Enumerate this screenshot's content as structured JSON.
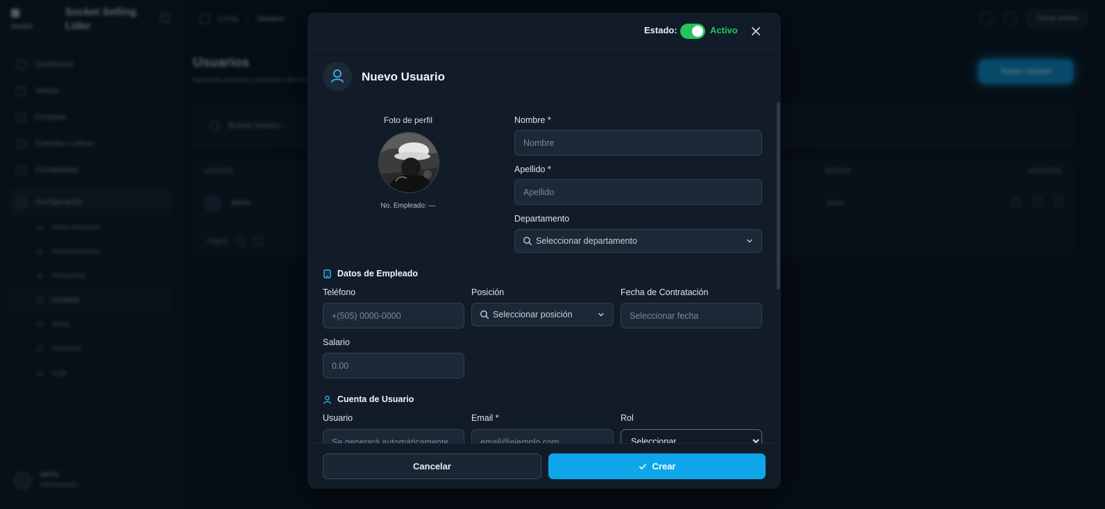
{
  "background": {
    "brand": {
      "subtitle": "Socket",
      "name_line1": "Socket Selling",
      "name_line2": "Líder"
    },
    "nav": [
      {
        "label": "Dashboard"
      },
      {
        "label": "Ventas"
      },
      {
        "label": "Compras"
      },
      {
        "label": "Cuentas x cobrar"
      },
      {
        "label": "Contabilidad"
      }
    ],
    "nav_group": "Configuración",
    "nav_sub": [
      {
        "label": "Datos empresa"
      },
      {
        "label": "Departamentos"
      },
      {
        "label": "Posiciones"
      },
      {
        "label": "Usuarios"
      },
      {
        "label": "Roles"
      },
      {
        "label": "Permisos"
      },
      {
        "label": "Logs"
      }
    ],
    "user": {
      "name": "admin",
      "role": "Administrador"
    },
    "breadcrumb": {
      "parent": "Config",
      "current": "Usuarios"
    },
    "logout_label": "Cerrar sesión",
    "page_title": "Usuarios",
    "page_subtitle": "Gestiona usuarios y permisos del sistema",
    "new_button": "Nuevo Usuario",
    "search_placeholder": "Buscar usuario...",
    "table_headers": {
      "user": "USUARIO",
      "status": "ESTADO",
      "actions": "ACCIONES"
    },
    "table_row": {
      "name": "admin",
      "status": "Activo"
    },
    "pager_label": "Página"
  },
  "modal": {
    "status_label": "Estado:",
    "status_value": "Activo",
    "status_on": true,
    "title": "Nuevo Usuario",
    "photo_label": "Foto de perfil",
    "employee_no": "No. Empleado: —",
    "fields": {
      "nombre": {
        "label": "Nombre *",
        "placeholder": "Nombre"
      },
      "apellido": {
        "label": "Apellido *",
        "placeholder": "Apellido"
      },
      "departamento": {
        "label": "Departamento",
        "placeholder": "Seleccionar departamento"
      },
      "telefono": {
        "label": "Teléfono",
        "placeholder": "+(505) 0000-0000"
      },
      "posicion": {
        "label": "Posición",
        "placeholder": "Seleccionar posición"
      },
      "fecha": {
        "label": "Fecha de Contratación",
        "placeholder": "Seleccionar fecha"
      },
      "salario": {
        "label": "Salario",
        "placeholder": "0.00"
      },
      "usuario": {
        "label": "Usuario",
        "placeholder": "Se generará automáticamente"
      },
      "email": {
        "label": "Email *",
        "placeholder": "email@ejemplo.com"
      },
      "rol": {
        "label": "Rol",
        "selected": "Seleccionar"
      }
    },
    "sections": {
      "employee": "Datos de Empleado",
      "account": "Cuenta de Usuario"
    },
    "buttons": {
      "cancel": "Cancelar",
      "create": "Crear"
    },
    "colors": {
      "accent": "#0ea5e9",
      "active": "#22c55e"
    }
  }
}
